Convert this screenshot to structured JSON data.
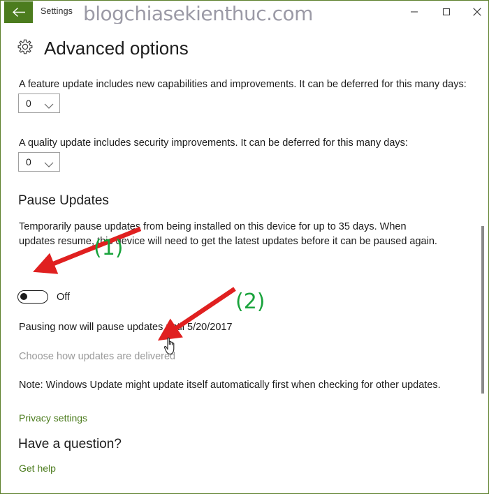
{
  "window": {
    "app_title": "Settings",
    "watermark": "blogchiasekienthuc.com",
    "back_icon": "arrow-left-icon",
    "minimize_label": "Minimize",
    "maximize_label": "Maximize",
    "close_label": "Close",
    "accent_color": "#4c7c1e",
    "border_color": "#5b7f2a",
    "watermark_color": "#9b9aa6"
  },
  "page": {
    "icon": "gear-icon",
    "title": "Advanced options"
  },
  "feature_update": {
    "description": "A feature update includes new capabilities and improvements. It can be deferred for this many days:",
    "value": "0",
    "options": [
      "0"
    ]
  },
  "quality_update": {
    "description": "A quality update includes security improvements. It can be deferred for this many days:",
    "value": "0",
    "options": [
      "0"
    ]
  },
  "pause_updates": {
    "heading": "Pause Updates",
    "description": "Temporarily pause updates from being installed on this device for up to 35 days. When updates resume, this device will need to get the latest updates before it can be paused again.",
    "toggle_state": "Off",
    "pause_until_text": "Pausing now will pause updates until 5/20/2017"
  },
  "links": {
    "choose_delivery": "Choose how updates are delivered",
    "privacy_settings": "Privacy settings",
    "get_help": "Get help",
    "link_color": "#4c7c1e",
    "disabled_color": "#9a9a9a"
  },
  "note": {
    "text": "Note: Windows Update might update itself automatically first when checking for other updates."
  },
  "help": {
    "heading": "Have a question?"
  },
  "annotations": {
    "marker_one": "(1)",
    "marker_two": "(2)",
    "arrow_color": "#e02020",
    "marker_color": "#19a33c",
    "cursor": "hand-pointer-cursor"
  }
}
